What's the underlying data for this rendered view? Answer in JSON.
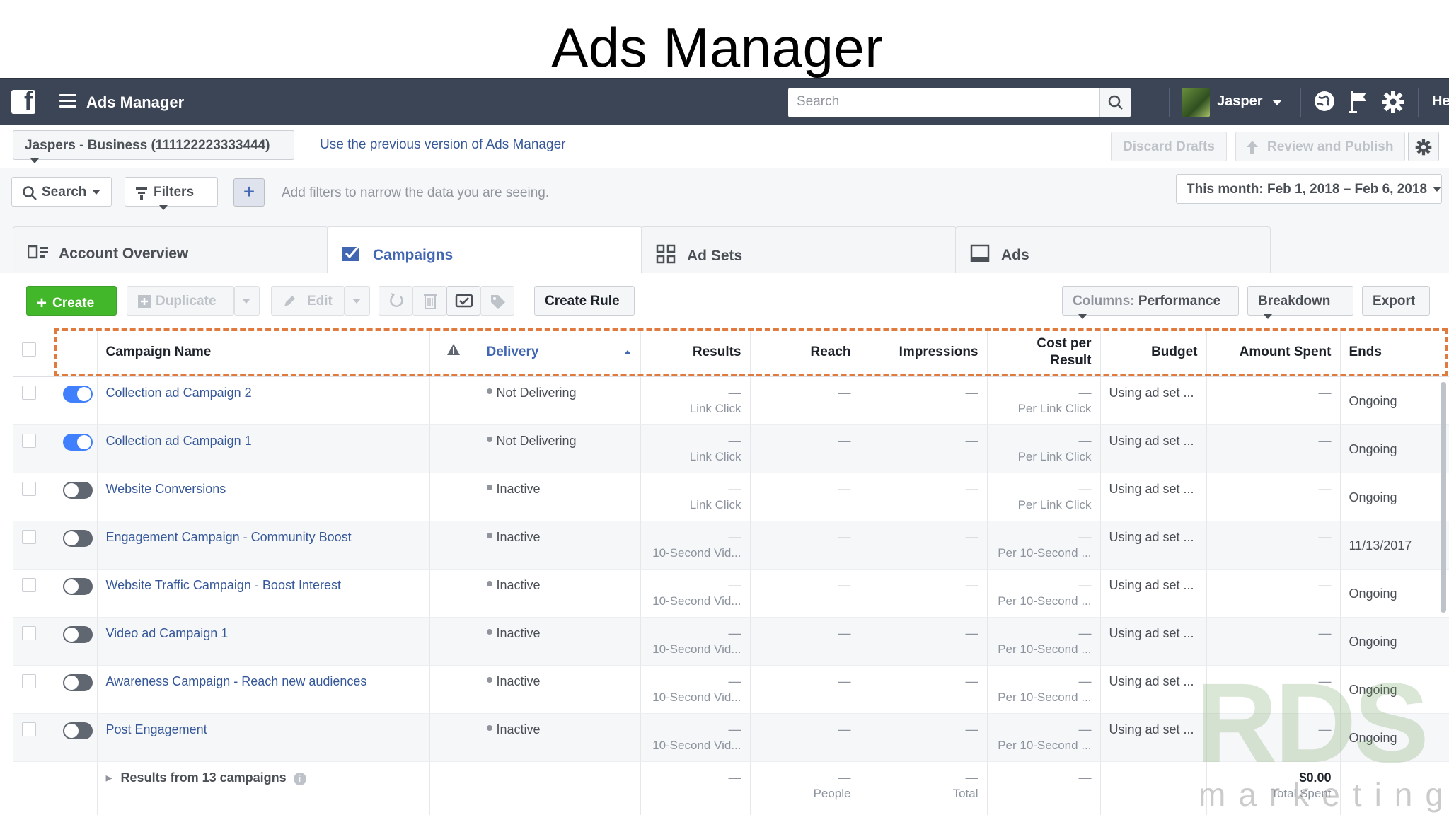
{
  "slide_title": "Ads Manager",
  "topbar": {
    "app_title": "Ads Manager",
    "search_placeholder": "Search",
    "user_name": "Jasper",
    "help_label": "He"
  },
  "account_bar": {
    "account_label": "Jaspers - Business (111122223333444)",
    "prev_version_link": "Use the previous version of Ads Manager",
    "discard_label": "Discard Drafts",
    "review_label": "Review and Publish"
  },
  "filter_bar": {
    "search_label": "Search",
    "filters_label": "Filters",
    "plus_label": "+",
    "hint": "Add filters to narrow the data you are seeing.",
    "date_range": "This month: Feb 1, 2018 – Feb 6, 2018"
  },
  "tabs": [
    {
      "label": "Account Overview"
    },
    {
      "label": "Campaigns"
    },
    {
      "label": "Ad Sets"
    },
    {
      "label": "Ads"
    }
  ],
  "toolbar": {
    "create_label": "Create",
    "duplicate_label": "Duplicate",
    "edit_label": "Edit",
    "create_rule_label": "Create Rule",
    "columns_prefix": "Columns:",
    "columns_value": "Performance",
    "breakdown_label": "Breakdown",
    "export_label": "Export"
  },
  "table": {
    "headers": {
      "campaign_name": "Campaign Name",
      "delivery": "Delivery",
      "results": "Results",
      "reach": "Reach",
      "impressions": "Impressions",
      "cost_line1": "Cost per",
      "cost_line2": "Result",
      "budget": "Budget",
      "amount_spent": "Amount Spent",
      "ends": "Ends"
    },
    "dash": "—",
    "rows": [
      {
        "name": "Collection ad Campaign 2",
        "on": true,
        "delivery": "Not Delivering",
        "result_type": "Link Click",
        "cost_type": "Per Link Click",
        "budget": "Using ad set ...",
        "ends": "Ongoing"
      },
      {
        "name": "Collection ad Campaign 1",
        "on": true,
        "delivery": "Not Delivering",
        "result_type": "Link Click",
        "cost_type": "Per Link Click",
        "budget": "Using ad set ...",
        "ends": "Ongoing"
      },
      {
        "name": "Website Conversions",
        "on": false,
        "delivery": "Inactive",
        "result_type": "Link Click",
        "cost_type": "Per Link Click",
        "budget": "Using ad set ...",
        "ends": "Ongoing"
      },
      {
        "name": "Engagement Campaign - Community Boost",
        "on": false,
        "delivery": "Inactive",
        "result_type": "10-Second Vid...",
        "cost_type": "Per 10-Second ...",
        "budget": "Using ad set ...",
        "ends": "11/13/2017"
      },
      {
        "name": "Website Traffic Campaign - Boost Interest",
        "on": false,
        "delivery": "Inactive",
        "result_type": "10-Second Vid...",
        "cost_type": "Per 10-Second ...",
        "budget": "Using ad set ...",
        "ends": "Ongoing"
      },
      {
        "name": "Video ad Campaign 1",
        "on": false,
        "delivery": "Inactive",
        "result_type": "10-Second Vid...",
        "cost_type": "Per 10-Second ...",
        "budget": "Using ad set ...",
        "ends": "Ongoing"
      },
      {
        "name": "Awareness Campaign - Reach new audiences",
        "on": false,
        "delivery": "Inactive",
        "result_type": "10-Second Vid...",
        "cost_type": "Per 10-Second ...",
        "budget": "Using ad set ...",
        "ends": "Ongoing"
      },
      {
        "name": "Post Engagement",
        "on": false,
        "delivery": "Inactive",
        "result_type": "10-Second Vid...",
        "cost_type": "Per 10-Second ...",
        "budget": "Using ad set ...",
        "ends": "Ongoing"
      }
    ],
    "summary": {
      "label": "Results from 13 campaigns",
      "reach_sub": "People",
      "impressions_sub": "Total",
      "amount": "$0.00",
      "amount_sub": "Total Spent"
    }
  },
  "watermark": {
    "big_text": "RDS",
    "small_text": "marketing"
  },
  "colors": {
    "topbar": "#3b4556",
    "link": "#365899",
    "accent": "#4267b2",
    "create": "#42b72a",
    "highlight": "#e07a3f"
  }
}
